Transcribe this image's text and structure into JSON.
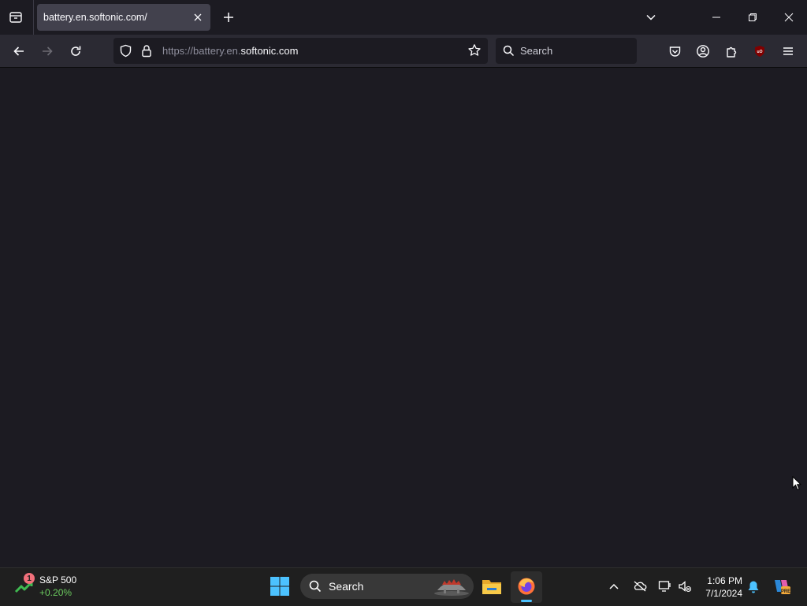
{
  "browser": {
    "tab": {
      "title": "battery.en.softonic.com/"
    },
    "url": {
      "scheme_prefix": "https://battery.en.",
      "domain": "softonic.com"
    },
    "search": {
      "placeholder": "Search"
    }
  },
  "taskbar": {
    "widget": {
      "badge": "1",
      "title": "S&P 500",
      "change": "+0.20%"
    },
    "search": {
      "label": "Search"
    },
    "clock": {
      "time": "1:06 PM",
      "date": "7/1/2024"
    }
  },
  "colors": {
    "background": "#1c1b22",
    "toolbar": "#2b2a33",
    "tab_active": "#42414d",
    "taskbar": "#1f1f1f",
    "accent": "#4cc2ff",
    "positive_change": "#6ccb5f"
  },
  "icons": {
    "tabbar": [
      "tab-list-icon",
      "close-icon",
      "plus-icon",
      "chevron-down-icon",
      "minimize-icon",
      "restore-icon",
      "close-window-icon"
    ],
    "navbar": [
      "back-arrow-icon",
      "forward-arrow-icon",
      "reload-icon",
      "shield-icon",
      "lock-icon",
      "star-icon",
      "search-icon",
      "pocket-icon",
      "account-icon",
      "extensions-icon",
      "ublock-origin-icon",
      "hamburger-menu-icon"
    ],
    "taskbar": [
      "stock-chart-icon",
      "windows-start-icon",
      "search-icon",
      "file-explorer-icon",
      "firefox-icon",
      "chevron-up-icon",
      "onedrive-icon",
      "display-icon",
      "speaker-muted-icon",
      "bell-icon",
      "copilot-icon"
    ]
  }
}
